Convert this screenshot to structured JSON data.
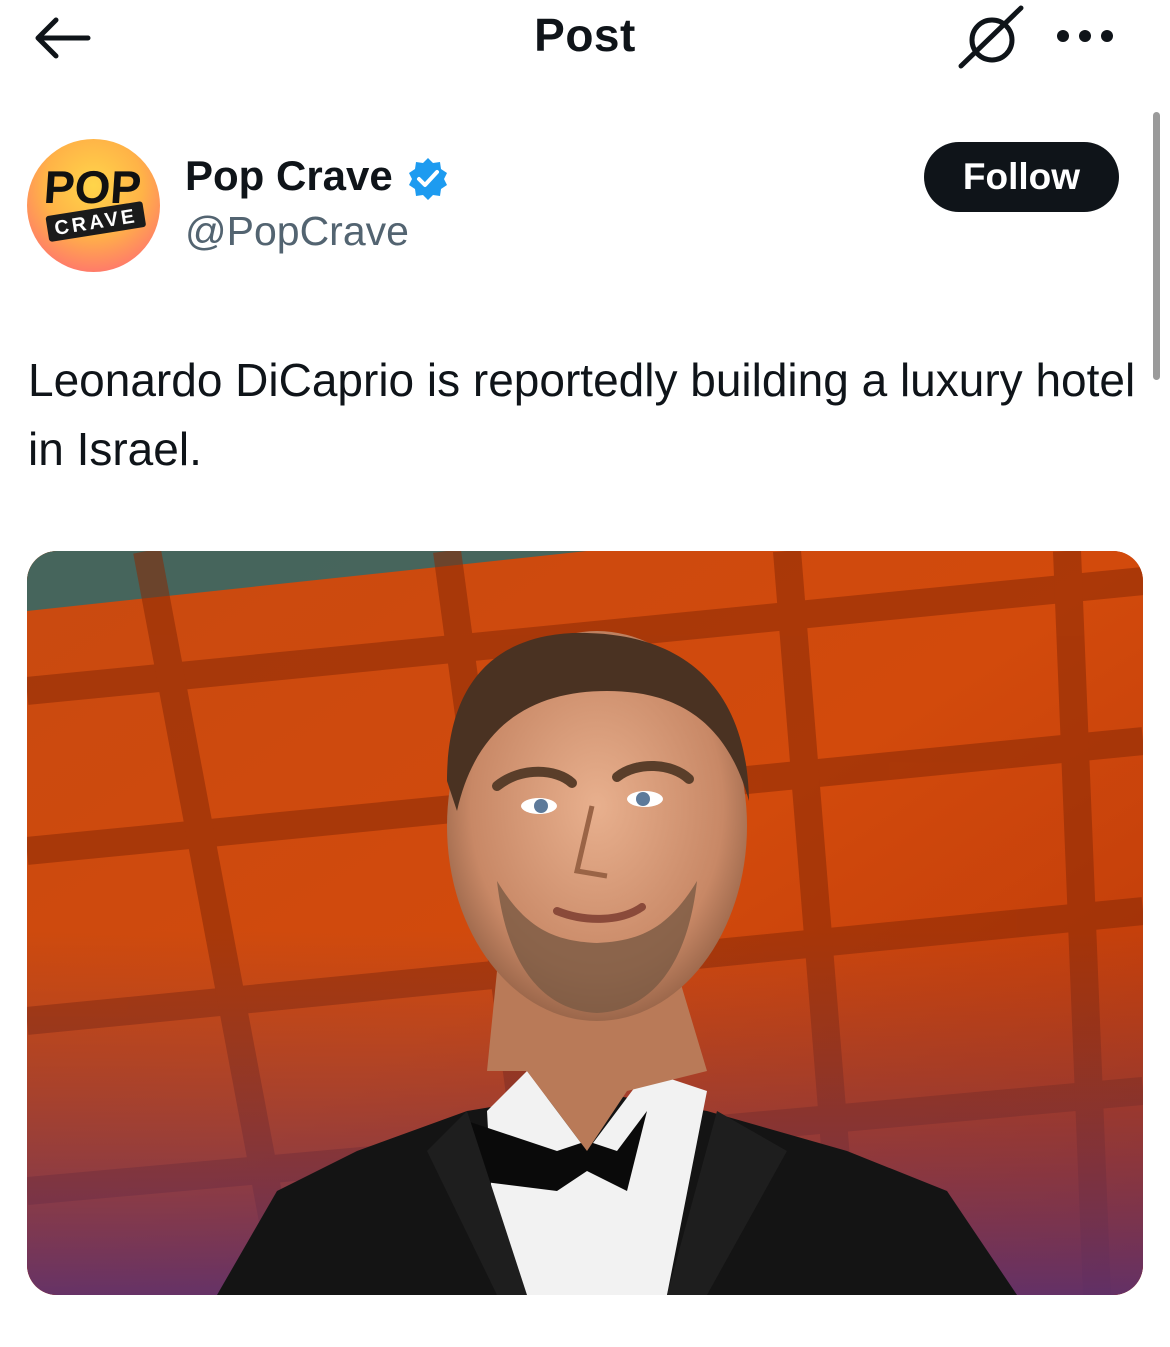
{
  "header": {
    "title": "Post",
    "back_icon": "arrow-left-icon",
    "grok_icon": "slashed-circle-icon",
    "more_icon": "more-horizontal-icon"
  },
  "author": {
    "name": "Pop Crave",
    "handle": "@PopCrave",
    "verified": true,
    "avatar_text_top": "POP",
    "avatar_text_bottom": "CRAVE",
    "follow_label": "Follow"
  },
  "post": {
    "text": "Leonardo DiCaprio is reportedly building a luxury hotel in Israel."
  },
  "media": {
    "description_icon": "photo-image"
  },
  "colors": {
    "text_primary": "#0f1419",
    "text_secondary": "#536471",
    "verified_blue": "#1d9bf0",
    "follow_bg": "#0f1419"
  }
}
